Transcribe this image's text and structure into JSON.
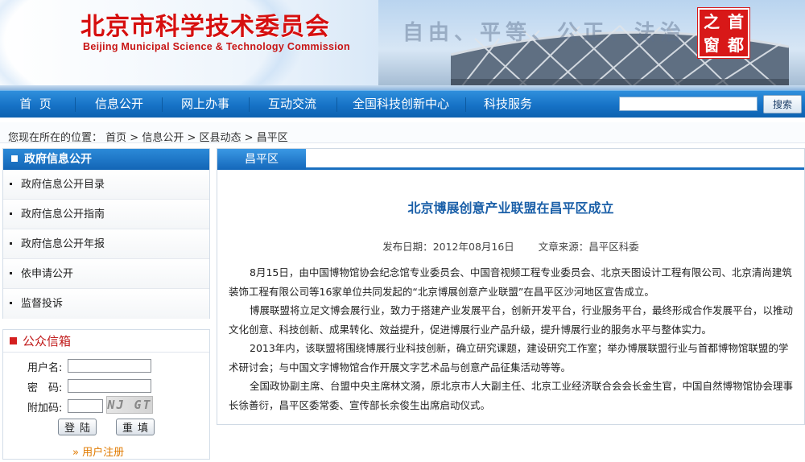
{
  "header": {
    "site_title": "北京市科学技术委员会",
    "site_subtitle": "Beijing Municipal Science & Technology Commission",
    "slogan": "自由、平等、公正、法治",
    "seal_chars": [
      "之",
      "首",
      "窗",
      "都"
    ]
  },
  "nav": {
    "items": [
      "首  页",
      "信息公开",
      "网上办事",
      "互动交流",
      "全国科技创新中心",
      "科技服务"
    ],
    "search_placeholder": "",
    "search_button": "搜索"
  },
  "breadcrumb": {
    "prefix": "您现在所在的位置：",
    "items": [
      "首页",
      "信息公开",
      "区县动态",
      "昌平区"
    ],
    "separator": " > "
  },
  "sidebar": {
    "title": "政府信息公开",
    "items": [
      "政府信息公开目录",
      "政府信息公开指南",
      "政府信息公开年报",
      "依申请公开",
      "监督投诉"
    ]
  },
  "mailbox": {
    "title": "公众信箱",
    "username_label": "用户名:",
    "password_label": "密　码:",
    "captcha_label": "附加码:",
    "captcha_text": "NJ GT",
    "login_button": "登陆",
    "reset_button": "重填",
    "register_link": "» 用户注册"
  },
  "main": {
    "tab_label": "昌平区",
    "article_title": "北京博展创意产业联盟在昌平区成立",
    "publish_date_label": "发布日期：",
    "publish_date": "2012年08月16日",
    "source_label": "文章来源：",
    "source": "昌平区科委",
    "paragraphs": [
      "8月15日，由中国博物馆协会纪念馆专业委员会、中国音视频工程专业委员会、北京天图设计工程有限公司、北京清尚建筑装饰工程有限公司等16家单位共同发起的“北京博展创意产业联盟”在昌平区沙河地区宣告成立。",
      "博展联盟将立足文博会展行业，致力于搭建产业发展平台，创新开发平台，行业服务平台，最终形成合作发展平台，以推动文化创意、科技创新、成果转化、效益提升，促进博展行业产品升级，提升博展行业的服务水平与整体实力。",
      "2013年内，该联盟将围绕博展行业科技创新，确立研究课题，建设研究工作室；举办博展联盟行业与首都博物馆联盟的学术研讨会；与中国文字博物馆合作开展文字艺术品与创意产品征集活动等等。",
      "全国政协副主席、台盟中央主席林文漪，原北京市人大副主任、北京工业经济联合会会长金生官，中国自然博物馆协会理事长徐善衍，昌平区委常委、宣传部长余俊生出席启动仪式。"
    ]
  },
  "colors": {
    "brand_red": "#d60f0f",
    "nav_blue": "#1672c6",
    "title_blue": "#1a5fa8",
    "link_orange": "#e07a00"
  }
}
